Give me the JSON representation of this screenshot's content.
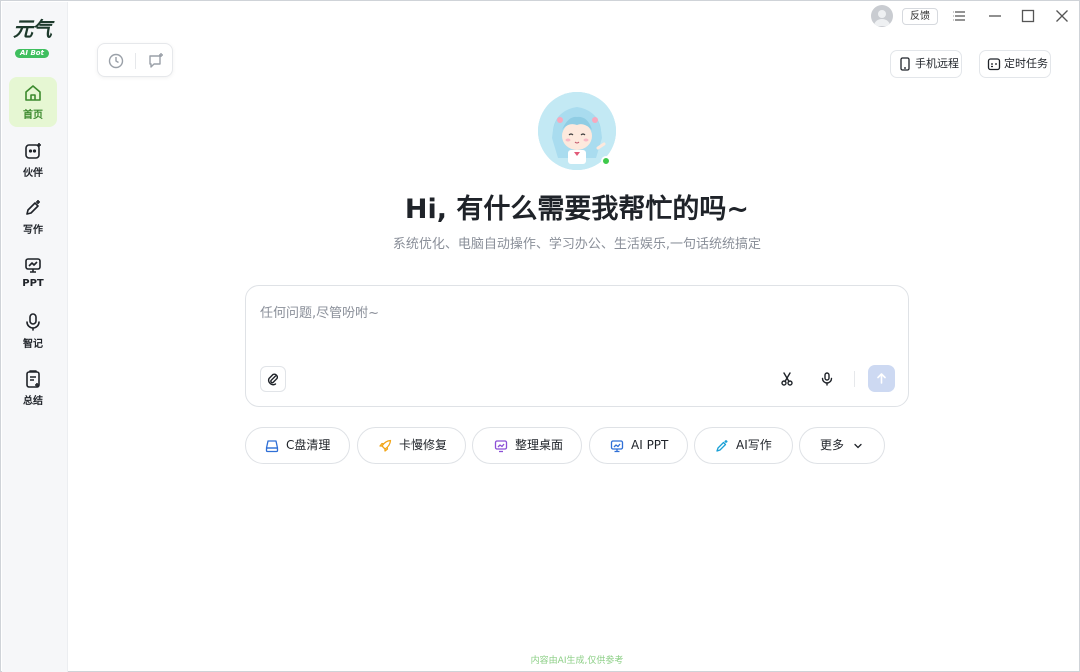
{
  "logo": {
    "text": "元气",
    "badge": "AI Bot"
  },
  "sidebar": {
    "items": [
      {
        "label": "首页",
        "icon": "home-icon",
        "active": true
      },
      {
        "label": "伙伴",
        "icon": "partner-icon",
        "active": false
      },
      {
        "label": "写作",
        "icon": "write-icon",
        "active": false
      },
      {
        "label": "PPT",
        "icon": "ppt-icon",
        "active": false
      },
      {
        "label": "智记",
        "icon": "mic-icon",
        "active": false
      },
      {
        "label": "总结",
        "icon": "summary-icon",
        "active": false
      }
    ]
  },
  "titlebar": {
    "feedback_label": "反馈"
  },
  "toolbar": {
    "phone_remote_label": "手机远程",
    "scheduled_task_label": "定时任务"
  },
  "hero": {
    "title": "Hi, 有什么需要我帮忙的吗~",
    "subtitle": "系统优化、电脑自动操作、学习办公、生活娱乐,一句话统统搞定"
  },
  "composer": {
    "placeholder": "任何问题,尽管吩咐~",
    "value": ""
  },
  "chips": [
    {
      "label": "C盘清理",
      "icon": "drive-icon"
    },
    {
      "label": "卡慢修复",
      "icon": "rocket-icon"
    },
    {
      "label": "整理桌面",
      "icon": "desktop-icon"
    },
    {
      "label": "AI PPT",
      "icon": "ppt-icon"
    },
    {
      "label": "AI写作",
      "icon": "write-icon"
    },
    {
      "label": "更多",
      "icon": "chevron-down-icon"
    }
  ],
  "footer": {
    "note": "内容由AI生成,仅供参考"
  },
  "colors": {
    "accent_green": "#3c8a2e",
    "active_bg": "#e6f7d3",
    "online": "#3ec94b",
    "send_disabled": "#cdd9f2"
  }
}
